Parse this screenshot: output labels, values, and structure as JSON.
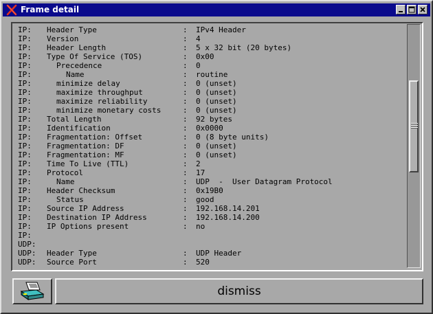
{
  "window": {
    "title": "Frame detail",
    "icon": "x-close-icon",
    "controls": [
      "minimize-icon",
      "maximize-icon",
      "close-icon"
    ]
  },
  "detail_lines": [
    {
      "proto": "IP:",
      "field": "Header Type",
      "indent": 0,
      "sep": ":",
      "value": "IPv4 Header"
    },
    {
      "proto": "IP:",
      "field": "Version",
      "indent": 0,
      "sep": ":",
      "value": "4"
    },
    {
      "proto": "IP:",
      "field": "Header Length",
      "indent": 0,
      "sep": ":",
      "value": "5 x 32 bit (20 bytes)"
    },
    {
      "proto": "IP:",
      "field": "Type Of Service (TOS)",
      "indent": 0,
      "sep": ":",
      "value": "0x00"
    },
    {
      "proto": "IP:",
      "field": "Precedence",
      "indent": 1,
      "sep": ":",
      "value": "0"
    },
    {
      "proto": "IP:",
      "field": "Name",
      "indent": 2,
      "sep": ":",
      "value": "routine"
    },
    {
      "proto": "IP:",
      "field": "minimize delay",
      "indent": 1,
      "sep": ":",
      "value": "0 (unset)"
    },
    {
      "proto": "IP:",
      "field": "maximize throughput",
      "indent": 1,
      "sep": ":",
      "value": "0 (unset)"
    },
    {
      "proto": "IP:",
      "field": "maximize reliability",
      "indent": 1,
      "sep": ":",
      "value": "0 (unset)"
    },
    {
      "proto": "IP:",
      "field": "minimize monetary costs",
      "indent": 1,
      "sep": ":",
      "value": "0 (unset)"
    },
    {
      "proto": "IP:",
      "field": "Total Length",
      "indent": 0,
      "sep": ":",
      "value": "92 bytes"
    },
    {
      "proto": "IP:",
      "field": "Identification",
      "indent": 0,
      "sep": ":",
      "value": "0x0000"
    },
    {
      "proto": "IP:",
      "field": "Fragmentation: Offset",
      "indent": 0,
      "sep": ":",
      "value": "0 (8 byte units)"
    },
    {
      "proto": "IP:",
      "field": "Fragmentation: DF",
      "indent": 0,
      "sep": ":",
      "value": "0 (unset)"
    },
    {
      "proto": "IP:",
      "field": "Fragmentation: MF",
      "indent": 0,
      "sep": ":",
      "value": "0 (unset)"
    },
    {
      "proto": "IP:",
      "field": "Time To Live (TTL)",
      "indent": 0,
      "sep": ":",
      "value": "2"
    },
    {
      "proto": "IP:",
      "field": "Protocol",
      "indent": 0,
      "sep": ":",
      "value": "17"
    },
    {
      "proto": "IP:",
      "field": "Name",
      "indent": 1,
      "sep": ":",
      "value": "UDP  -  User Datagram Protocol"
    },
    {
      "proto": "IP:",
      "field": "Header Checksum",
      "indent": 0,
      "sep": ":",
      "value": "0x19B0"
    },
    {
      "proto": "IP:",
      "field": "Status",
      "indent": 1,
      "sep": ":",
      "value": "good"
    },
    {
      "proto": "IP:",
      "field": "Source IP Address",
      "indent": 0,
      "sep": ":",
      "value": "192.168.14.201"
    },
    {
      "proto": "IP:",
      "field": "Destination IP Address",
      "indent": 0,
      "sep": ":",
      "value": "192.168.14.200"
    },
    {
      "proto": "IP:",
      "field": "IP Options present",
      "indent": 0,
      "sep": ":",
      "value": "no"
    },
    {
      "proto": "IP:",
      "field": "",
      "indent": 0,
      "sep": "",
      "value": ""
    },
    {
      "proto": "UDP:",
      "field": "",
      "indent": 0,
      "sep": "",
      "value": ""
    },
    {
      "proto": "UDP:",
      "field": "Header Type",
      "indent": 0,
      "sep": ":",
      "value": "UDP Header"
    },
    {
      "proto": "UDP:",
      "field": "Source Port",
      "indent": 0,
      "sep": ":",
      "value": "520"
    }
  ],
  "buttons": {
    "print_icon": "printer-icon",
    "dismiss_label": "dismiss"
  },
  "colors": {
    "titlebar": "#0a0a8c",
    "background": "#a8a8a8"
  }
}
